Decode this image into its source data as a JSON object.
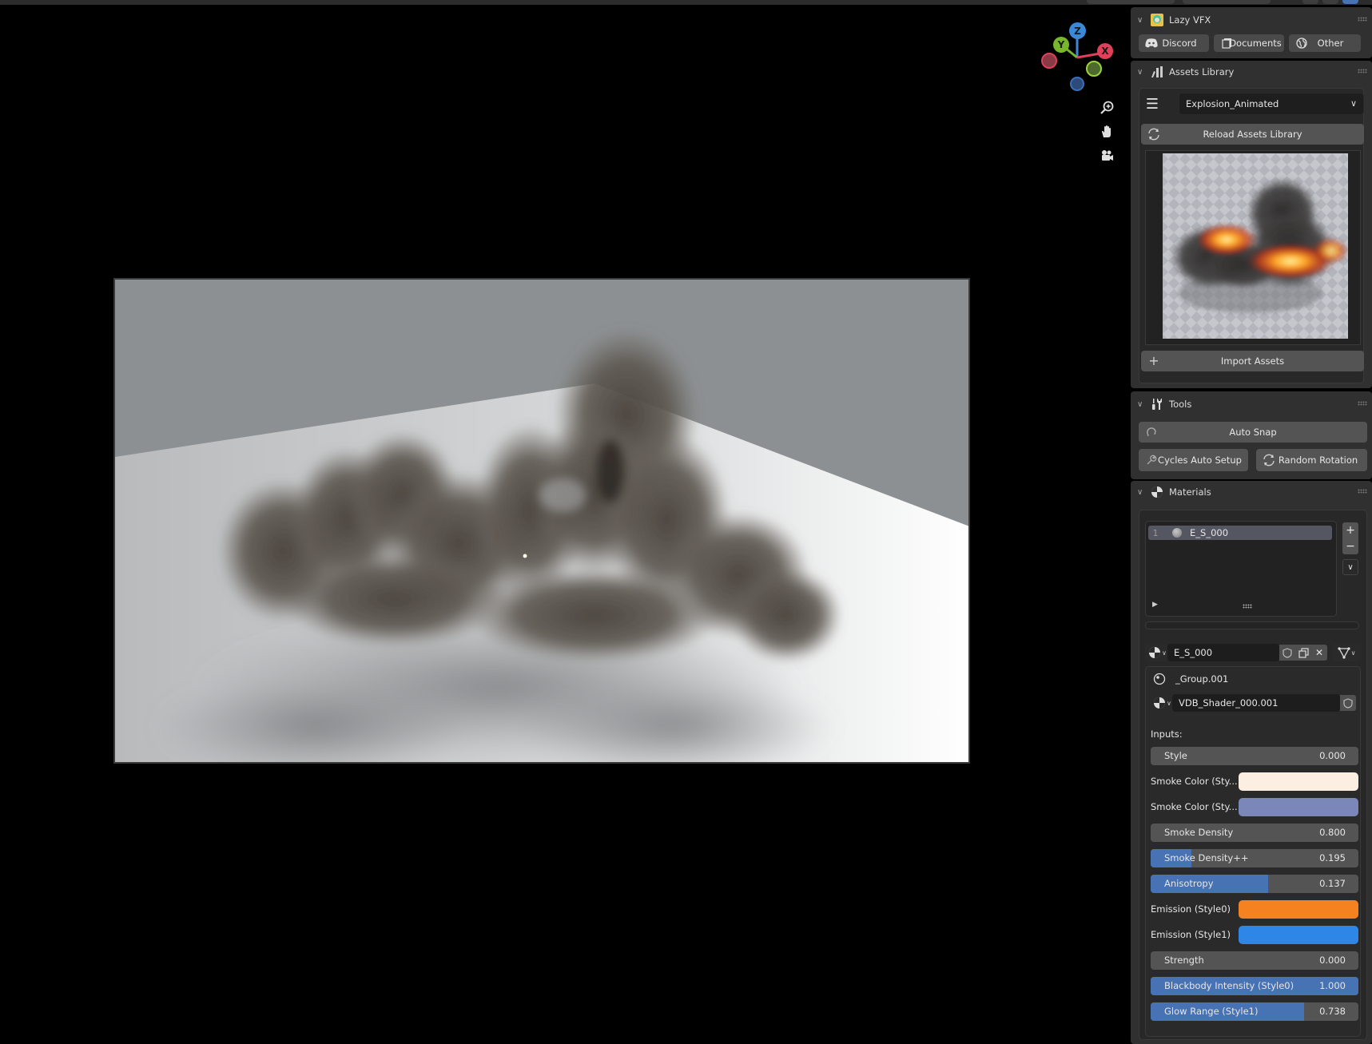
{
  "viewport": {
    "gizmo": {
      "x_label": "X",
      "y_label": "Y",
      "z_label": "Z"
    },
    "nav_icons": [
      "zoom-icon",
      "pan-hand-icon",
      "camera-icon"
    ]
  },
  "panel": {
    "lazy_vfx": {
      "title": "Lazy VFX",
      "buttons": [
        {
          "label": "Discord",
          "icon": "discord-icon"
        },
        {
          "label": "Documents",
          "icon": "documents-icon"
        },
        {
          "label": "Other",
          "icon": "globe-icon"
        }
      ]
    },
    "assets_library": {
      "title": "Assets Library",
      "category": "Explosion_Animated",
      "reload_label": "Reload Assets Library",
      "import_label": "Import Assets",
      "preview_alt": "Explosion preview thumbnail"
    },
    "tools": {
      "title": "Tools",
      "auto_snap_label": "Auto Snap",
      "cycles_label": "Cycles Auto Setup",
      "random_rotation_label": "Random Rotation"
    },
    "materials": {
      "title": "Materials",
      "slots": [
        {
          "index": "1",
          "name": "E_S_000"
        }
      ],
      "material_name": "E_S_000",
      "group_name": "_Group.001",
      "node_group": "VDB_Shader_000.001",
      "inputs_label": "Inputs:",
      "inputs": [
        {
          "type": "slider",
          "label": "Style",
          "value": "0.000",
          "fill": 0.0
        },
        {
          "type": "color",
          "label": "Smoke Color (Sty...",
          "color": "#fdeee2"
        },
        {
          "type": "color",
          "label": "Smoke Color (Sty...",
          "color": "#7a87b8"
        },
        {
          "type": "slider",
          "label": "Smoke Density",
          "value": "0.800",
          "fill": 0.0
        },
        {
          "type": "slider",
          "label": "Smoke Density++",
          "value": "0.195",
          "fill": 0.195
        },
        {
          "type": "slider",
          "label": "Anisotropy",
          "value": "0.137",
          "fill": 0.565
        },
        {
          "type": "color",
          "label": "Emission (Style0)",
          "color": "#f58220"
        },
        {
          "type": "color",
          "label": "Emission (Style1)",
          "color": "#2e86e6"
        },
        {
          "type": "slider",
          "label": "Strength",
          "value": "0.000",
          "fill": 0.0
        },
        {
          "type": "slider",
          "label": "Blackbody Intensity  (Style0)",
          "value": "1.000",
          "fill": 1.0
        },
        {
          "type": "slider",
          "label": "Glow Range (Style1)",
          "value": "0.738",
          "fill": 0.738
        }
      ]
    }
  },
  "colors": {
    "accent_blue": "#4772b3",
    "panel_bg": "#303030",
    "button_bg": "#545454",
    "axis_x": "#e0415a",
    "axis_y": "#78b72b",
    "axis_z": "#3b88d8"
  }
}
